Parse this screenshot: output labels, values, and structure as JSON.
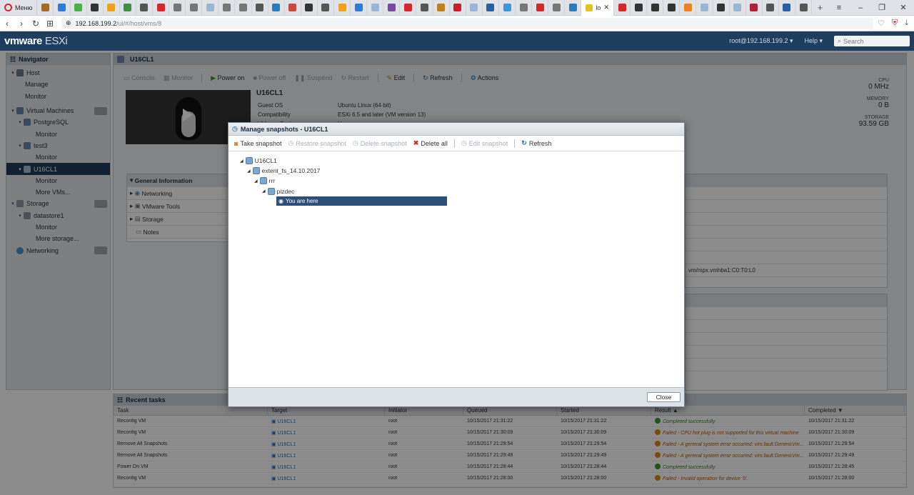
{
  "browser": {
    "menu_label": "Меню",
    "active_tab_label": "lo",
    "url_host": "192.168.199.2",
    "url_path": "/ui/#/host/vms/8"
  },
  "header": {
    "logo_brand": "vmware",
    "logo_product": "ESXi",
    "user": "root@192.168.199.2 ▾",
    "help": "Help ▾",
    "search_placeholder": "Search"
  },
  "navigator": {
    "title": "Navigator",
    "items": [
      {
        "label": "Host"
      },
      {
        "label": "Manage"
      },
      {
        "label": "Monitor"
      },
      {
        "label": "Virtual Machines"
      },
      {
        "label": "PostgreSQL"
      },
      {
        "label": "Monitor"
      },
      {
        "label": "test3"
      },
      {
        "label": "Monitor"
      },
      {
        "label": "U16CL1"
      },
      {
        "label": "Monitor"
      },
      {
        "label": "More VMs..."
      },
      {
        "label": "Storage"
      },
      {
        "label": "datastore1"
      },
      {
        "label": "Monitor"
      },
      {
        "label": "More storage..."
      },
      {
        "label": "Networking"
      }
    ]
  },
  "vm": {
    "panel_title": "U16CL1",
    "toolbar": {
      "console": "Console",
      "monitor": "Monitor",
      "power_on": "Power on",
      "power_off": "Power off",
      "suspend": "Suspend",
      "restart": "Restart",
      "edit": "Edit",
      "refresh": "Refresh",
      "actions": "Actions"
    },
    "name": "U16CL1",
    "info": [
      {
        "key": "Guest OS",
        "value": "Ubuntu Linux (64-bit)"
      },
      {
        "key": "Compatibility",
        "value": "ESXi 6.5 and later (VM version 13)"
      },
      {
        "key": "VMware Tools",
        "value": "Yes"
      }
    ],
    "stats": {
      "cpu_label": "CPU",
      "cpu_value": "0 MHz",
      "memory_label": "MEMORY",
      "memory_value": "0 B",
      "storage_label": "STORAGE",
      "storage_value": "93.59 GB"
    },
    "general_info": {
      "title": "General Information",
      "items": [
        "Networking",
        "VMware Tools",
        "Storage",
        "Notes"
      ]
    },
    "hw_device_text": "vm/mpx.vmhba1:C0:T0:L0"
  },
  "dialog": {
    "title": "Manage snapshots - U16CL1",
    "toolbar": {
      "take": "Take snapshot",
      "restore": "Restore snapshot",
      "delete": "Delete snapshot",
      "delete_all": "Delete all",
      "edit": "Edit snapshot",
      "refresh": "Refresh"
    },
    "tree": [
      {
        "label": "U16CL1"
      },
      {
        "label": "extent_fs_14.10.2017"
      },
      {
        "label": "rrr"
      },
      {
        "label": "pizdec"
      }
    ],
    "current": "You are here",
    "close": "Close"
  },
  "recent_tasks": {
    "title": "Recent tasks",
    "columns": [
      "Task",
      "Target",
      "Initiator",
      "Queued",
      "Started",
      "Result ▲",
      "Completed ▼"
    ],
    "rows": [
      {
        "task": "Reconfig VM",
        "target": "U16CL1",
        "initiator": "root",
        "queued": "10/15/2017 21:31:22",
        "started": "10/15/2017 21:31:22",
        "result": "Completed successfully",
        "completed": "10/15/2017 21:31:22"
      },
      {
        "task": "Reconfig VM",
        "target": "U16CL1",
        "initiator": "root",
        "queued": "10/15/2017 21:30:09",
        "started": "10/15/2017 21:30:09",
        "result": "Failed - CPU hot plug is not supported for this virtual machine",
        "completed": "10/15/2017 21:30:09"
      },
      {
        "task": "Remove All Snapshots",
        "target": "U16CL1",
        "initiator": "root",
        "queued": "10/15/2017 21:29:54",
        "started": "10/15/2017 21:29:54",
        "result": "Failed - A general system error occurred: vim.fault.GenericVm...",
        "completed": "10/15/2017 21:29:54"
      },
      {
        "task": "Remove All Snapshots",
        "target": "U16CL1",
        "initiator": "root",
        "queued": "10/15/2017 21:29:49",
        "started": "10/15/2017 21:29:49",
        "result": "Failed - A general system error occurred: vim.fault.GenericVm...",
        "completed": "10/15/2017 21:29:49"
      },
      {
        "task": "Power On VM",
        "target": "U16CL1",
        "initiator": "root",
        "queued": "10/15/2017 21:28:44",
        "started": "10/15/2017 21:28:44",
        "result": "Completed successfully",
        "completed": "10/15/2017 21:28:45"
      },
      {
        "task": "Reconfig VM",
        "target": "U16CL1",
        "initiator": "root",
        "queued": "10/15/2017 21:28:00",
        "started": "10/15/2017 21:28:00",
        "result": "Failed - Invalid operation for device '0'.",
        "completed": "10/15/2017 21:28:00"
      }
    ]
  },
  "colors": {
    "accent": "#1f3d5c",
    "success": "#3a9d2a",
    "warning": "#e08a00",
    "danger": "#d9262a"
  }
}
